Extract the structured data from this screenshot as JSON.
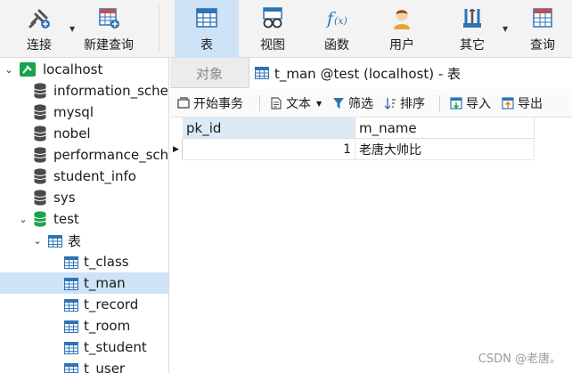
{
  "toolbar": {
    "connect": "连接",
    "new_query": "新建查询",
    "table": "表",
    "view": "视图",
    "function": "函数",
    "user": "用户",
    "other": "其它",
    "query": "查询"
  },
  "sidebar": {
    "connection": "localhost",
    "databases": [
      "information_schema",
      "mysql",
      "nobel",
      "performance_schema",
      "student_info",
      "sys",
      "test"
    ],
    "tables_group": "表",
    "tables": [
      "t_class",
      "t_man",
      "t_record",
      "t_room",
      "t_student",
      "t_user"
    ],
    "selected_table": "t_man"
  },
  "tabs": {
    "objects": "对象",
    "active": "t_man @test (localhost) - 表"
  },
  "subbar": {
    "begin_transaction": "开始事务",
    "text": "文本",
    "filter": "筛选",
    "sort": "排序",
    "import": "导入",
    "export": "导出"
  },
  "grid": {
    "columns": [
      "pk_id",
      "m_name"
    ],
    "rows": [
      [
        "1",
        "老唐大帅比"
      ]
    ]
  },
  "watermark": "CSDN @老唐。",
  "colors": {
    "active_bg": "#cfe3f7",
    "db_icon": "#4a4a4a",
    "db_open": "#1aa34a",
    "table_icon": "#2e74b5"
  }
}
